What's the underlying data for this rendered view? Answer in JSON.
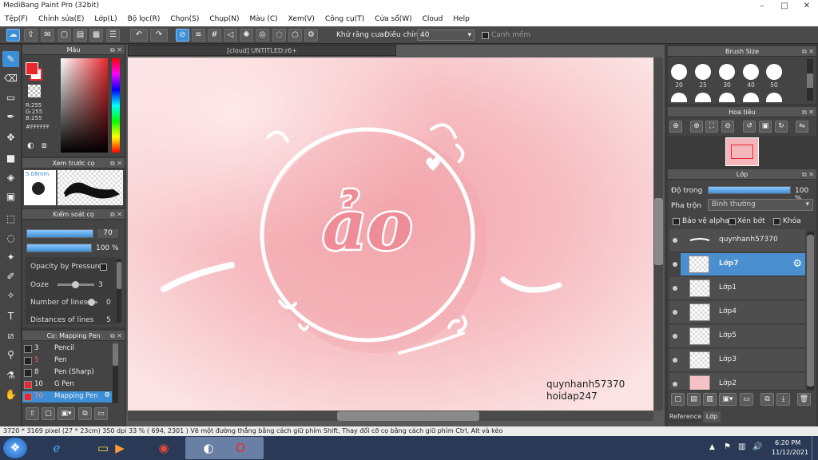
{
  "app": {
    "title": "MediBang Paint Pro (32bit)"
  },
  "menu": [
    "Tệp(F)",
    "Chỉnh sửa(E)",
    "Lớp(L)",
    "Bộ lọc(R)",
    "Chọn(S)",
    "Chụp(N)",
    "Màu (C)",
    "Xem(V)",
    "Công cụ(T)",
    "Cửa sổ(W)",
    "Cloud",
    "Help"
  ],
  "toolbar": {
    "antialias_label": "Khử răng cưa",
    "adjust_label": "Điều chỉnh",
    "adjust_value": "40",
    "sharp_label": "Cạnh mềm"
  },
  "color_panel": {
    "title": "Màu",
    "r": "R:255",
    "g": "G:255",
    "b": "B:255",
    "hex": "#FFFFFF",
    "fg": "#ffffff",
    "bg": "#e8282c"
  },
  "brush_preview": {
    "title": "Xem trước cọ",
    "size": "5.08mm"
  },
  "brush_control": {
    "title": "Kiểm soát cọ",
    "size_value": "70",
    "opacity_value": "100 %",
    "opacity_pressure": "Opacity by Pressure",
    "ooze_label": "Ooze",
    "ooze_value": "3",
    "lines_label": "Number of lines",
    "lines_value": "0",
    "distance_label": "Distances of lines",
    "distance_value": "5"
  },
  "brush_list": {
    "title": "Cọ: Mapping Pen",
    "items": [
      {
        "num": "3",
        "name": "Pencil",
        "color": "#222222",
        "red": false
      },
      {
        "num": "5",
        "name": "Pen",
        "color": "#222222",
        "red": true
      },
      {
        "num": "8",
        "name": "Pen (Sharp)",
        "color": "#222222",
        "red": false
      },
      {
        "num": "10",
        "name": "G Pen",
        "color": "#e8282c",
        "red": false
      },
      {
        "num": "70",
        "name": "Mapping Pen",
        "color": "#e8282c",
        "red": true
      }
    ]
  },
  "document": {
    "tab": "[cloud] UNTITLED:r6+",
    "main_text": "ảo",
    "watermark1": "quynhanh57370",
    "watermark2": "hoidap247"
  },
  "brush_size": {
    "title": "Brush Size",
    "sizes": [
      "20",
      "25",
      "30",
      "40",
      "50"
    ]
  },
  "navigator": {
    "title": "Hoa tiêu"
  },
  "layers_panel": {
    "title": "Lớp",
    "opacity_label": "Độ trong",
    "opacity_value": "100 %",
    "opacity_fraction": 1.0,
    "blend_label": "Pha trộn",
    "blend_value": "Bình thường",
    "protect_alpha": "Bảo vệ alpha",
    "clipping": "Xén bớt",
    "lock": "Khóa",
    "layers": [
      "quynhanh57370",
      "Lớp7",
      "Lớp1",
      "Lớp4",
      "Lớp5",
      "Lớp3",
      "Lớp2"
    ],
    "tab_reference": "Reference",
    "tab_layer": "Lớp"
  },
  "status": {
    "text": "3720 * 3169 pixel   (27 * 23cm)   350 dpi   33 %   ( 694, 2301 )   Vẽ một đường thẳng bằng cách giữ phím Shift, Thay đổi cỡ cọ bằng cách giữ phím Ctrl, Alt và kéo"
  },
  "taskbar": {
    "time": "6:20 PM",
    "date": "11/12/2021"
  },
  "brush_control_fill": {
    "size_fraction": 0.7,
    "opacity_fraction": 1.0
  }
}
